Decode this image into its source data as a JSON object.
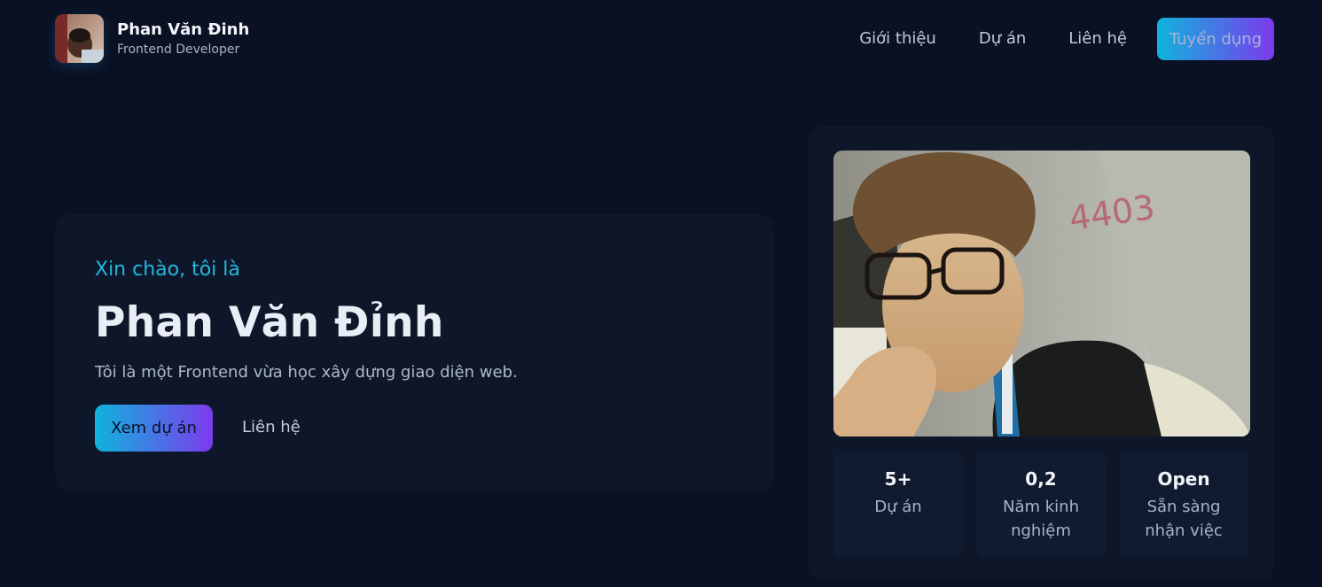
{
  "brand": {
    "name": "Phan Văn Đinh",
    "role": "Frontend Developer"
  },
  "nav": {
    "items": [
      "Giới thiệu",
      "Dự án",
      "Liên hệ"
    ],
    "cta": "Tuyển dụng"
  },
  "hero": {
    "greeting": "Xin chào, tôi là",
    "title": "Phan Văn Đỉnh",
    "description": "Tôi là một Frontend vừa học xây dựng giao diện web.",
    "primary_button": "Xem dự án",
    "secondary_link": "Liên hệ"
  },
  "stats": [
    {
      "value": "5+",
      "label": "Dự án"
    },
    {
      "value": "0,2",
      "label": "Năm kinh nghiệm"
    },
    {
      "value": "Open",
      "label": "Sẵn sàng nhận việc"
    }
  ],
  "colors": {
    "background": "#0a1123",
    "card": "#0e1729",
    "accent_cyan": "#10b3dc",
    "accent_purple": "#7c3aed"
  }
}
